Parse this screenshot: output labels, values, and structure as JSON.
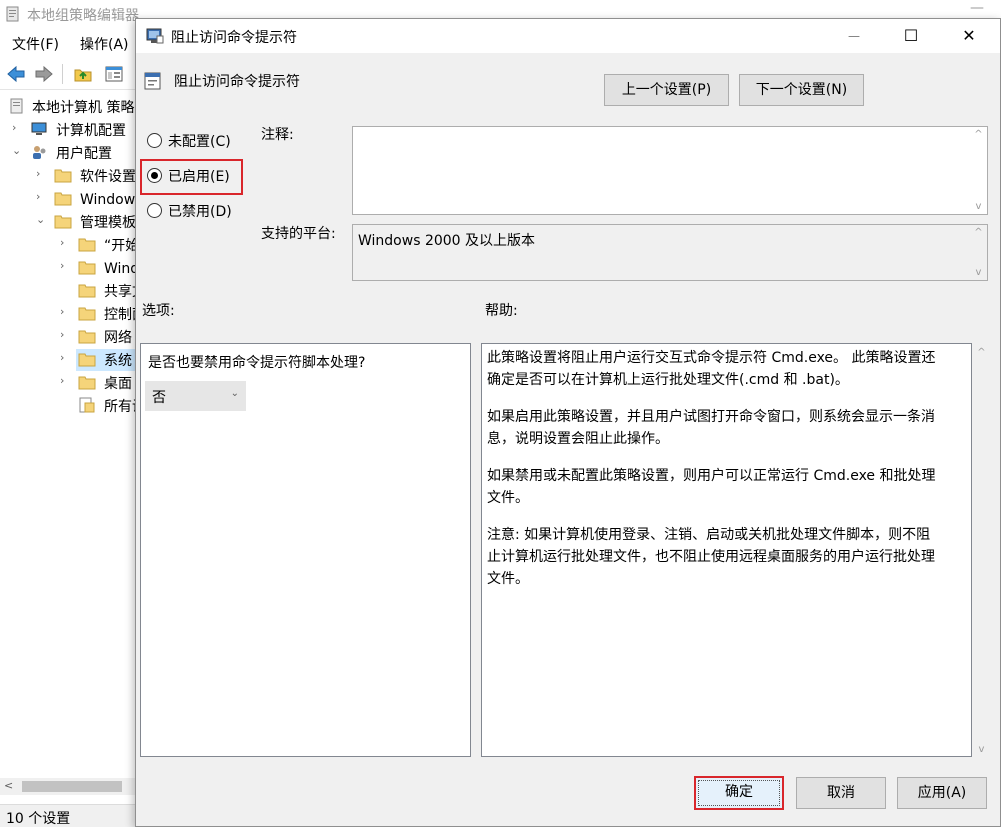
{
  "background_window": {
    "title": "本地组策略编辑器",
    "minimize_glyph": "—",
    "menu": [
      "文件(F)",
      "操作(A)"
    ],
    "tree": [
      {
        "label": "本地计算机 策略",
        "chev": ""
      },
      {
        "label": "计算机配置",
        "chev": "›"
      },
      {
        "label": "用户配置",
        "chev": "⌄"
      },
      {
        "label": "软件设置",
        "chev": "›"
      },
      {
        "label": "Windows 设置",
        "chev": "›"
      },
      {
        "label": "管理模板",
        "chev": "⌄"
      },
      {
        "label": "“开始”菜单和任务栏",
        "chev": "›"
      },
      {
        "label": "Windows 组件",
        "chev": "›"
      },
      {
        "label": "共享文件夹",
        "chev": ""
      },
      {
        "label": "控制面板",
        "chev": "›"
      },
      {
        "label": "网络",
        "chev": "›"
      },
      {
        "label": "系统",
        "chev": "›"
      },
      {
        "label": "桌面",
        "chev": "›"
      },
      {
        "label": "所有设置",
        "chev": ""
      }
    ],
    "status": "10 个设置"
  },
  "dialog": {
    "title": "阻止访问命令提示符",
    "header_title": "阻止访问命令提示符",
    "prev_button": "上一个设置(P)",
    "next_button": "下一个设置(N)",
    "radios": [
      {
        "label": "未配置(C)",
        "checked": false
      },
      {
        "label": "已启用(E)",
        "checked": true
      },
      {
        "label": "已禁用(D)",
        "checked": false
      }
    ],
    "comment_label": "注释:",
    "comment_value": "",
    "platform_label": "支持的平台:",
    "platform_value": "Windows 2000 及以上版本",
    "options_label": "选项:",
    "help_label": "帮助:",
    "option_question": "是否也要禁用命令提示符脚本处理?",
    "option_value": "否",
    "help_paragraphs": [
      [
        "此策略设置将阻止用户运行交互式命令提示符 Cmd.exe。 此策略设置还",
        "确定是否可以在计算机上运行批处理文件(.cmd 和 .bat)。"
      ],
      [
        "如果启用此策略设置，并且用户试图打开命令窗口，则系统会显示一条消",
        "息，说明设置会阻止此操作。"
      ],
      [
        "如果禁用或未配置此策略设置，则用户可以正常运行 Cmd.exe 和批处理",
        "文件。"
      ],
      [
        "注意: 如果计算机使用登录、注销、启动或关机批处理文件脚本，则不阻",
        "止计算机运行批处理文件，也不阻止使用远程桌面服务的用户运行批处理",
        "文件。"
      ]
    ],
    "ok_button": "确定",
    "cancel_button": "取消",
    "apply_button": "应用(A)",
    "window_buttons": {
      "minimize": "—",
      "maximize": "☐",
      "close": "✕"
    }
  },
  "colors": {
    "highlight_red": "#d9262b",
    "selection_blue": "#cce8ff",
    "dialog_bg": "#f0f0f0"
  }
}
